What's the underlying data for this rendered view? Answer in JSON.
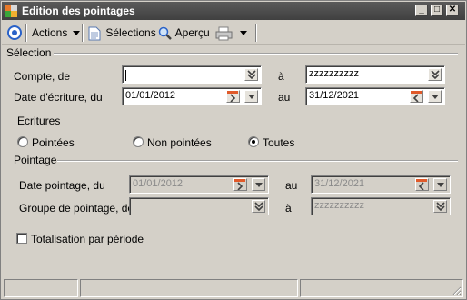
{
  "window": {
    "title": "Edition des pointages",
    "controls": {
      "minimize": "_",
      "maximize": "□",
      "close": "✕"
    }
  },
  "toolbar": {
    "actions_label": "Actions",
    "selections_label": "Sélections",
    "preview_label": "Aperçu"
  },
  "selection": {
    "group_label": "Sélection",
    "account_label": "Compte, de",
    "account_from": "",
    "account_to_label": "à",
    "account_to": "zzzzzzzzzz",
    "date_label": "Date d'écriture, du",
    "date_from": "01/01/2012",
    "date_to_label": "au",
    "date_to": "31/12/2021"
  },
  "ecritures": {
    "group_label": "Ecritures",
    "options": [
      {
        "label": "Pointées",
        "selected": false
      },
      {
        "label": "Non pointées",
        "selected": false
      },
      {
        "label": "Toutes",
        "selected": true
      }
    ]
  },
  "pointage": {
    "group_label": "Pointage",
    "date_label": "Date pointage, du",
    "date_from": "01/01/2012",
    "date_to_label": "au",
    "date_to": "31/12/2021",
    "group_field_label": "Groupe de pointage, de",
    "group_from": "",
    "group_to_label": "à",
    "group_to": "zzzzzzzzzz"
  },
  "totalisation": {
    "label": "Totalisation par période",
    "checked": false
  },
  "colors": {
    "titlebar": "#404040",
    "window_bg": "#d4d0c8",
    "calendar_accent": "#e05a2a"
  }
}
